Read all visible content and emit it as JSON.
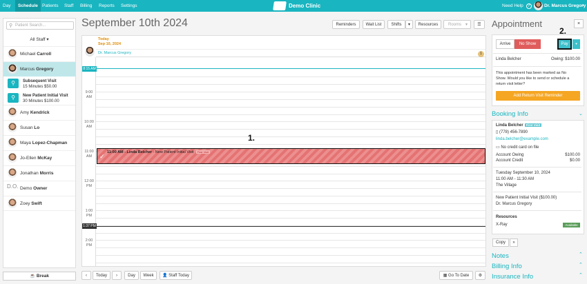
{
  "nav": {
    "items": [
      "Day",
      "Schedule",
      "Patients",
      "Staff",
      "Billing",
      "Reports",
      "Settings"
    ],
    "active": "Schedule",
    "clinic": "Demo Clinic",
    "help": "Need Help",
    "help_icon": "?",
    "user": "Dr. Marcus Gregory"
  },
  "sidebar": {
    "search_placeholder": "Patient Search...",
    "staff_filter": "All Staff",
    "staff": [
      {
        "first": "Michael",
        "last": "Carroll"
      },
      {
        "first": "Marcus",
        "last": "Gregory"
      },
      {
        "first": "Amy",
        "last": "Kendrick"
      },
      {
        "first": "Susan",
        "last": "Lo"
      },
      {
        "first": "Maya",
        "last": "Lopez-Chapman"
      },
      {
        "first": "Jo-Ellen",
        "last": "McKay"
      },
      {
        "first": "Jonathan",
        "last": "Morris"
      },
      {
        "first": "Demo",
        "last": "Owner"
      },
      {
        "first": "Zoey",
        "last": "Swift"
      }
    ],
    "appt_types": [
      {
        "name": "Subsequent Visit",
        "detail": "15 Minutes $50.00"
      },
      {
        "name": "New Patient Initial Visit",
        "detail": "30 Minutes $100.00"
      }
    ],
    "initials": "D.O.",
    "break": "Break"
  },
  "calendar": {
    "title": "September 10th 2024",
    "toolbar": {
      "reminders": "Reminders",
      "waitlist": "Wait List",
      "shifts": "Shifts",
      "resources": "Resources",
      "rooms": "Rooms"
    },
    "today_label": "Today",
    "today_date": "Sep 10, 2024",
    "column_doctor": "Dr. Marcus Gregory",
    "column_badge": "1",
    "hours": [
      {
        "t": "9:00",
        "ap": "AM"
      },
      {
        "t": "10:00",
        "ap": "AM"
      },
      {
        "t": "11:00",
        "ap": "AM"
      },
      {
        "t": "12:00",
        "ap": "PM"
      },
      {
        "t": "1:00",
        "ap": "PM"
      },
      {
        "t": "2:00",
        "ap": "PM"
      }
    ],
    "start_chip": "8:15 AM",
    "now_chip": "1:37 PM",
    "appointment": {
      "time": "11:00 AM - Linda Belcher",
      "type": "- New Patient Initial Visit",
      "tag": "First Visit"
    },
    "bottom": {
      "today": "Today",
      "day": "Day",
      "week": "Week",
      "staff_today": "Staff Today",
      "goto": "Go To Date"
    }
  },
  "annotations": {
    "a1": "1.",
    "a2": "2."
  },
  "panel": {
    "title": "Appointment",
    "close": "×",
    "arrive": "Arrive",
    "noshow": "No Show",
    "pay": "Pay",
    "patient": "Linda Belcher",
    "owing": "Owing: $100.00",
    "message": [
      "This appointment has been marked as No",
      "Show. Would you like to send or schedule a",
      "return visit letter?"
    ],
    "reminder_btn": "Add Return Visit Reminder",
    "booking_info": "Booking Info",
    "first_visit": "First Visit",
    "phone": "(778) 456-7890",
    "email": "linda.belcher@example.com",
    "no_card": "No credit card on file",
    "account_owing_label": "Account Owing",
    "account_owing": "$100.00",
    "account_credit_label": "Account Credit",
    "account_credit": "$0.00",
    "date": "Tuesday September 10, 2024",
    "time": "11:00 AM - 11:30 AM",
    "location": "The Village",
    "visit": "New Patient Initial Visit ($100.00)",
    "doctor": "Dr. Marcus Gregory",
    "resources_label": "Resources",
    "resource": "X-Ray",
    "available": "Available",
    "copy": "Copy",
    "notes": "Notes",
    "billing": "Billing Info",
    "insurance": "Insurance Info"
  }
}
